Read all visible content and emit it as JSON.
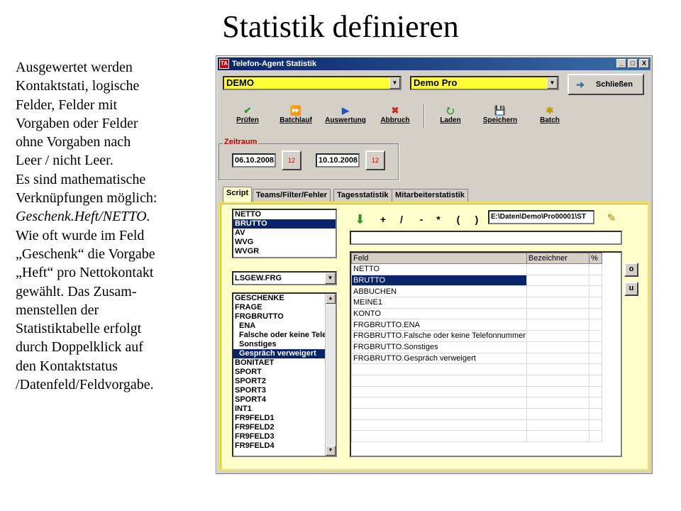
{
  "slide": {
    "title": "Statistik definieren",
    "lines": [
      "Ausgewertet werden",
      "Kontaktstati, logische",
      "Felder, Felder mit",
      "Vorgaben oder Felder",
      "ohne Vorgaben nach",
      "Leer / nicht Leer.",
      "Es sind mathematische",
      "Verknüpfungen möglich:",
      "Geschenk.Heft/NETTO.",
      "Wie oft wurde im Feld",
      "„Geschenk“ die Vorgabe",
      "„Heft“ pro Nettokontakt",
      "gewählt. Das Zusam-",
      "menstellen der",
      "Statistiktabelle erfolgt",
      "durch Doppelklick auf",
      "den Kontaktstatus",
      "/Datenfeld/Feldvorgabe."
    ]
  },
  "window": {
    "title": "Telefon-Agent Statistik",
    "controls": [
      "_",
      "□",
      "X"
    ],
    "project_combo": "DEMO",
    "campaign_combo": "Demo Pro",
    "close_button": "Schließen",
    "toolbar": [
      {
        "label": "Prüfen",
        "icon": "check-icon"
      },
      {
        "label": "Batchlauf",
        "icon": "fast-forward-icon"
      },
      {
        "label": "Auswertung",
        "icon": "play-icon"
      },
      {
        "label": "Abbruch",
        "icon": "stop-icon"
      },
      {
        "label": "Laden",
        "icon": "load-icon"
      },
      {
        "label": "Speichern",
        "icon": "floppy-disk-icon"
      },
      {
        "label": "Batch",
        "icon": "star-icon"
      }
    ],
    "date_range": {
      "label": "Zeitraum",
      "from": "06.10.2008",
      "to": "10.10.2008",
      "calendar_text": "12"
    },
    "tabs": [
      "Script",
      "Teams/Filter/Fehler",
      "Tagesstatistik",
      "Mitarbeiterstatistik"
    ],
    "active_tab": "Script",
    "status_list": [
      "NETTO",
      "BRUTTO",
      "AV",
      "WVG",
      "WVGR"
    ],
    "status_list_selected": 1,
    "field_combo": "LSGEW.FRG",
    "field_list": [
      {
        "text": "GESCHENKE",
        "indent": false
      },
      {
        "text": "FRAGE",
        "indent": false
      },
      {
        "text": "FRGBRUTTO",
        "indent": false
      },
      {
        "text": "ENA",
        "indent": true
      },
      {
        "text": "Falsche oder keine Telefonnummer",
        "indent": true
      },
      {
        "text": "Sonstiges",
        "indent": true
      },
      {
        "text": "Gespräch verweigert",
        "indent": true
      },
      {
        "text": "BONITAET",
        "indent": false
      },
      {
        "text": "SPORT",
        "indent": false
      },
      {
        "text": "SPORT2",
        "indent": false
      },
      {
        "text": "SPORT3",
        "indent": false
      },
      {
        "text": "SPORT4",
        "indent": false
      },
      {
        "text": "INT1",
        "indent": false
      },
      {
        "text": "FR9FELD1",
        "indent": false
      },
      {
        "text": "FR9FELD2",
        "indent": false
      },
      {
        "text": "FR9FELD3",
        "indent": false
      },
      {
        "text": "FR9FELD4",
        "indent": false
      }
    ],
    "field_list_selected": 6,
    "operators": [
      "+",
      "/",
      "-",
      "*",
      "(",
      ")"
    ],
    "path": "E:\\Daten\\Demo\\Pro00001\\ST",
    "grid": {
      "columns": [
        "Feld",
        "Bezeichner",
        "%"
      ],
      "rows": [
        "NETTO",
        "BRUTTO",
        "ABBUCHEN",
        "MEINE1",
        "KONTO",
        "FRGBRUTTO.ENA",
        "FRGBRUTTO.Falsche oder keine Telefonnummer",
        "FRGBRUTTO.Sonstiges",
        "FRGBRUTTO.Gespräch verweigert"
      ],
      "selected": 1
    },
    "side_buttons": [
      "o",
      "u"
    ]
  }
}
